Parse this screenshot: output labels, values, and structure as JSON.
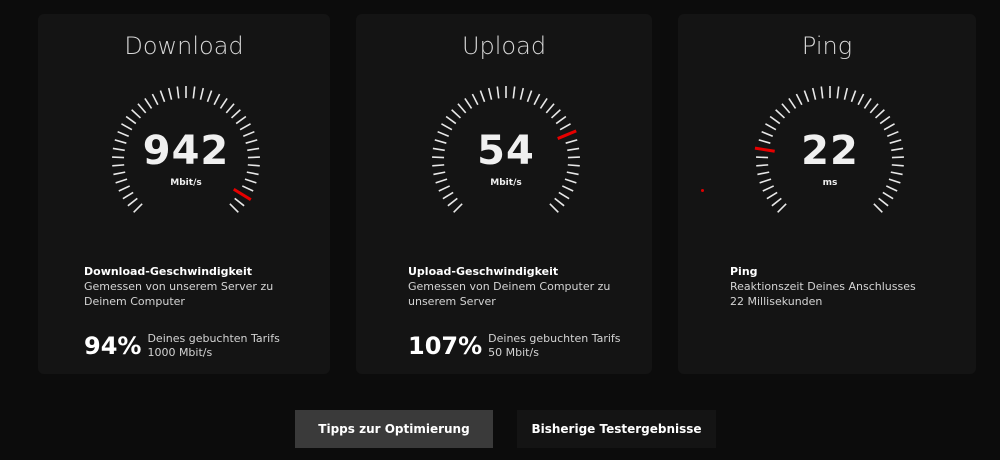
{
  "download": {
    "title": "Download",
    "value": "942",
    "unit": "Mbit/s",
    "level": 0.94,
    "info_heading": "Download-Geschwindigkeit",
    "info_line1": "Gemessen von unserem Server zu",
    "info_line2": "Deinem Computer",
    "percent": "94%",
    "tariff_line1": "Deines gebuchten Tarifs",
    "tariff_line2": "1000 Mbit/s"
  },
  "upload": {
    "title": "Upload",
    "value": "54",
    "unit": "Mbit/s",
    "level": 0.75,
    "info_heading": "Upload-Geschwindigkeit",
    "info_line1": "Gemessen von Deinem Computer zu",
    "info_line2": "unserem Server",
    "percent": "107%",
    "tariff_line1": "Deines gebuchten Tarifs",
    "tariff_line2": "50 Mbit/s"
  },
  "ping": {
    "title": "Ping",
    "value": "22",
    "unit": "ms",
    "level": 0.2,
    "info_heading": "Ping",
    "info_line1": "Reaktionszeit Deines Anschlusses",
    "info_line2": "22 Millisekunden"
  },
  "buttons": {
    "tips": "Tipps zur Optimierung",
    "history": "Bisherige Testergebnisse"
  },
  "colors": {
    "background": "#0c0c0c",
    "card": "#141414",
    "tick": "#e8e8e8",
    "indicator": "#e60000",
    "primary_button": "#3a3a3a"
  }
}
